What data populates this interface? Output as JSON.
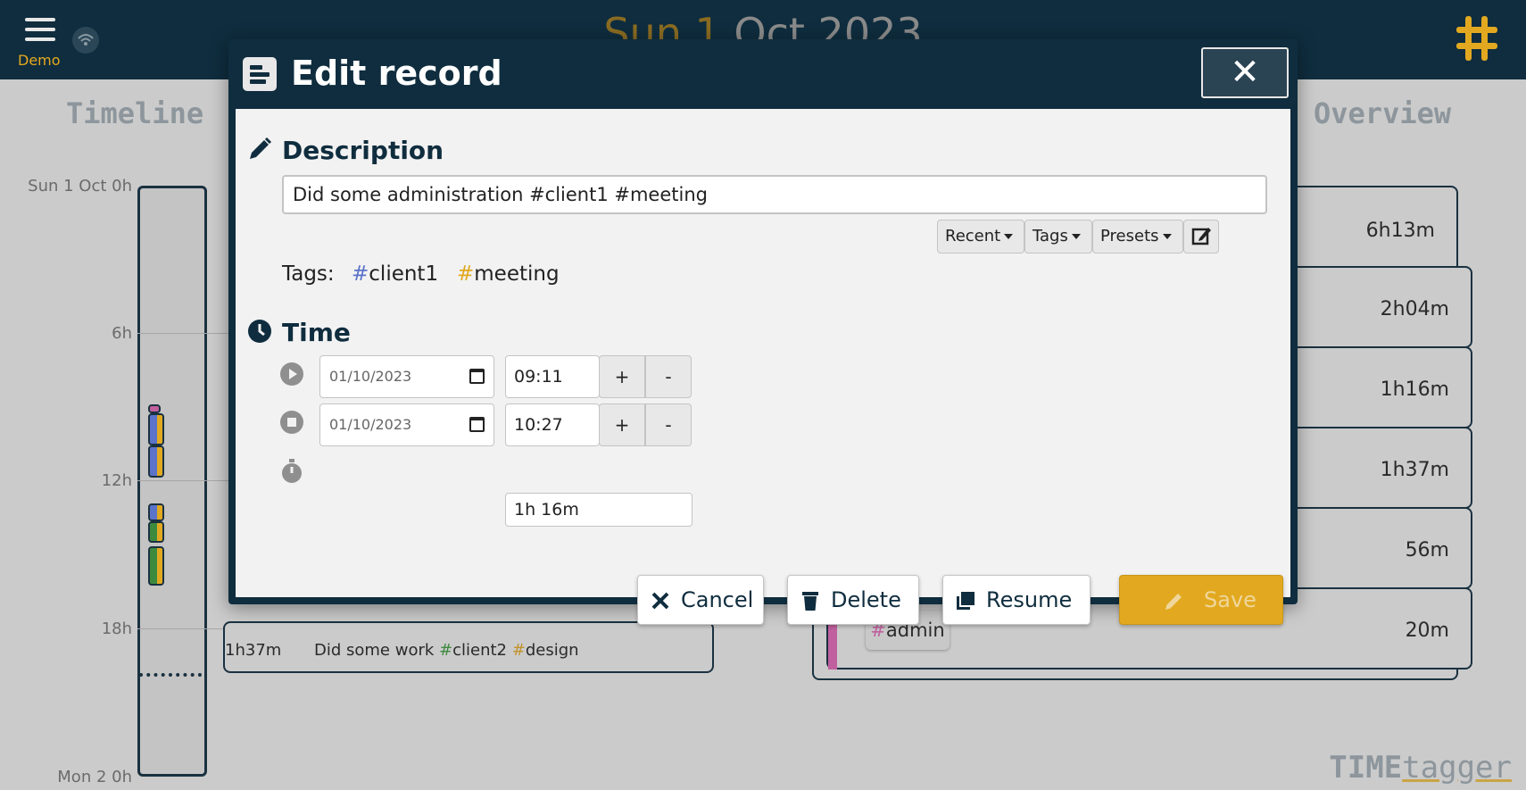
{
  "topbar": {
    "demo_label": "Demo",
    "date_prefix": "Sun 1",
    "date_rest": "Oct 2023"
  },
  "timeline": {
    "heading": "Timeline",
    "ticks": [
      "Sun 1 Oct 0h",
      "6h",
      "12h",
      "18h",
      "Mon 2 0h"
    ]
  },
  "overview": {
    "heading": "Overview",
    "values": [
      "6h13m",
      "2h04m",
      "1h16m",
      "1h37m",
      "56m",
      "20m"
    ],
    "admin_tag_hash": "#",
    "admin_tag_name": "admin"
  },
  "bg_record": {
    "duration": "1h37m",
    "desc_text": "Did some work ",
    "tag1_hash": "#",
    "tag1_name": "client2",
    "tag2_hash": "#",
    "tag2_name": "design"
  },
  "brand": {
    "part1": "TIME",
    "part2": "tagger"
  },
  "dialog": {
    "title": "Edit record",
    "close_label": "✕",
    "description_heading": "Description",
    "description_value": "Did some administration #client1 #meeting",
    "buttons": {
      "recent": "Recent",
      "tags": "Tags",
      "presets": "Presets"
    },
    "tags_label": "Tags:",
    "tags": [
      {
        "hash": "#",
        "name": "client1",
        "color": "#5b73c9"
      },
      {
        "hash": "#",
        "name": "meeting",
        "color": "#e2a920"
      }
    ],
    "time_heading": "Time",
    "start_date": "01/10/2023",
    "start_time": "09:11",
    "stop_date": "01/10/2023",
    "stop_time": "10:27",
    "plus": "+",
    "minus": "-",
    "duration": "1h 16m",
    "actions": {
      "cancel": "Cancel",
      "delete": "Delete",
      "resume": "Resume",
      "save": "Save"
    }
  },
  "colors": {
    "navy": "#0f2d3e",
    "accent_yellow": "#e2a920",
    "tag_blue": "#5b73c9",
    "tag_green": "#3d8a3f",
    "tag_pink": "#c0609e"
  }
}
